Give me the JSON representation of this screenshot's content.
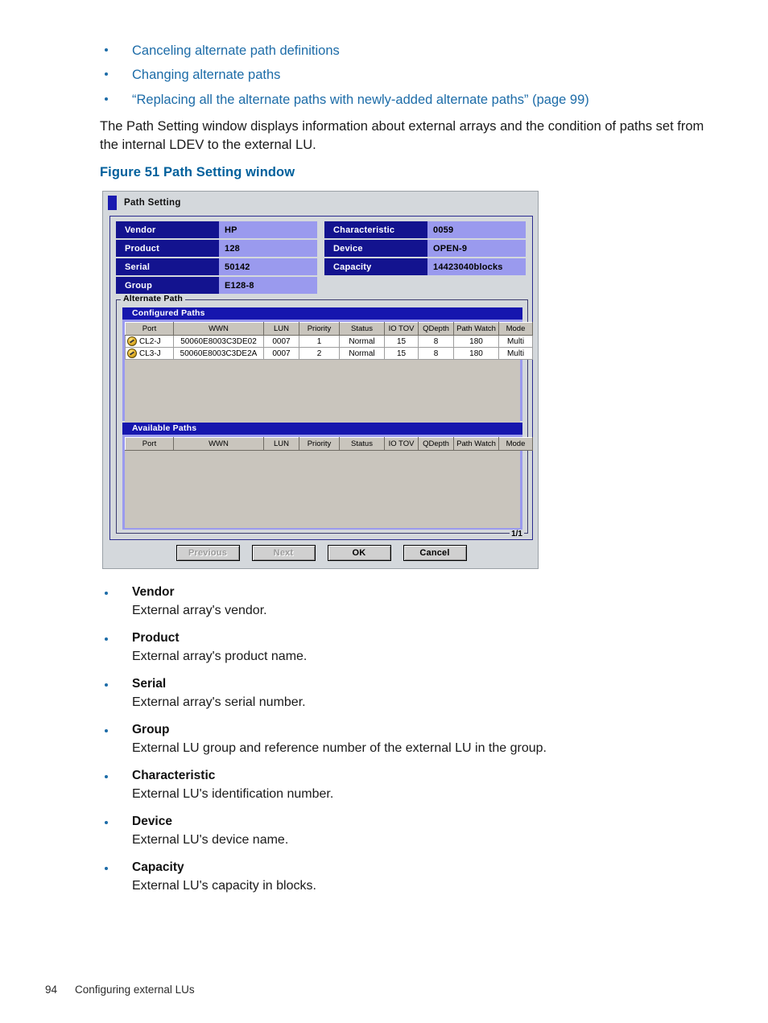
{
  "doc": {
    "links": [
      "Canceling alternate path definitions",
      "Changing alternate paths",
      "“Replacing all the alternate paths with newly-added alternate paths” (page 99)"
    ],
    "paragraph": "The Path Setting window displays information about external arrays and the condition of paths set from the internal LDEV to the external LU.",
    "figure_caption": "Figure 51 Path Setting window",
    "footer": {
      "page_number": "94",
      "chapter": "Configuring external LUs"
    }
  },
  "dialog": {
    "title": "Path Setting",
    "info_fields": {
      "left": [
        {
          "label": "Vendor",
          "value": "HP"
        },
        {
          "label": "Product",
          "value": "128"
        },
        {
          "label": "Serial",
          "value": "50142"
        },
        {
          "label": "Group",
          "value": "E128-8"
        }
      ],
      "right": [
        {
          "label": "Characteristic",
          "value": "0059"
        },
        {
          "label": "Device",
          "value": "OPEN-9"
        },
        {
          "label": "Capacity",
          "value": "14423040blocks"
        }
      ]
    },
    "groupbox": {
      "legend": "Alternate Path",
      "page_indicator": "1/1"
    },
    "configured_paths": {
      "title": "Configured Paths",
      "columns": [
        "Port",
        "WWN",
        "LUN",
        "Priority",
        "Status",
        "IO TOV",
        "QDepth",
        "Path Watch",
        "Mode"
      ],
      "rows": [
        {
          "icon": "path-status-icon",
          "Port": "CL2-J",
          "WWN": "50060E8003C3DE02",
          "LUN": "0007",
          "Priority": "1",
          "Status": "Normal",
          "IO TOV": "15",
          "QDepth": "8",
          "Path Watch": "180",
          "Mode": "Multi"
        },
        {
          "icon": "path-status-icon",
          "Port": "CL3-J",
          "WWN": "50060E8003C3DE2A",
          "LUN": "0007",
          "Priority": "2",
          "Status": "Normal",
          "IO TOV": "15",
          "QDepth": "8",
          "Path Watch": "180",
          "Mode": "Multi"
        }
      ]
    },
    "available_paths": {
      "title": "Available Paths",
      "columns": [
        "Port",
        "WWN",
        "LUN",
        "Priority",
        "Status",
        "IO TOV",
        "QDepth",
        "Path Watch",
        "Mode"
      ],
      "rows": []
    },
    "buttons": [
      {
        "label": "Previous",
        "disabled": true
      },
      {
        "label": "Next",
        "disabled": true
      },
      {
        "label": "OK",
        "disabled": false
      },
      {
        "label": "Cancel",
        "disabled": false
      }
    ]
  },
  "definitions": [
    {
      "term": "Vendor",
      "desc": "External array's vendor."
    },
    {
      "term": "Product",
      "desc": "External array's product name."
    },
    {
      "term": "Serial",
      "desc": "External array's serial number."
    },
    {
      "term": "Group",
      "desc": "External LU group and reference number of the external LU in the group."
    },
    {
      "term": "Characteristic",
      "desc": "External LU's identification number."
    },
    {
      "term": "Device",
      "desc": "External LU's device name."
    },
    {
      "term": "Capacity",
      "desc": "External LU's capacity in blocks."
    }
  ],
  "colors": {
    "link_blue": "#1D6CA8",
    "caption_blue": "#00609C",
    "label_navy": "#13138F",
    "value_lavender": "#9A9AEE",
    "panel_title_blue": "#1616AE",
    "dialog_gray": "#D4D8DC"
  }
}
